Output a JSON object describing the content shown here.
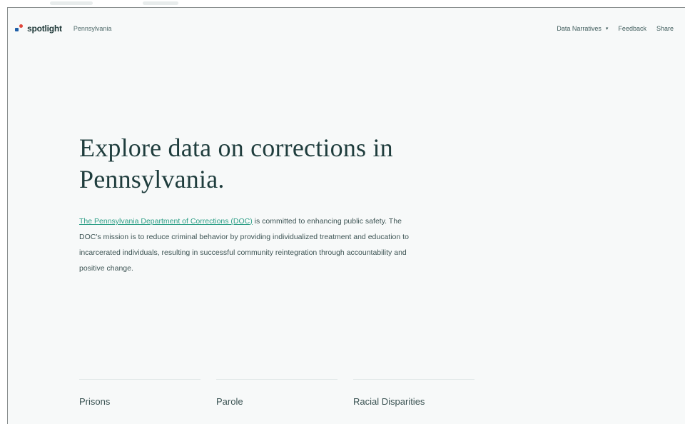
{
  "nav": {
    "brand": "spotlight",
    "state": "Pennsylvania",
    "data_narratives_label": "Data Narratives",
    "feedback_label": "Feedback",
    "share_label": "Share"
  },
  "hero": {
    "title": "Explore data on corrections in Pennsylvania.",
    "intro_link": "The Pennsylvania Department of Corrections (DOC)",
    "intro_text": " is committed to enhancing public safety. The DOC's mission is to reduce criminal behavior by providing individualized treatment and education to incarcerated individuals, resulting in successful community reintegration through accountability and positive change."
  },
  "cards": [
    {
      "label": "Prisons"
    },
    {
      "label": "Parole"
    },
    {
      "label": "Racial Disparities"
    }
  ],
  "colors": {
    "accent_link": "#2c9e86",
    "title_text": "#1f3d3d",
    "logo_blue": "#1f5fa8",
    "logo_red": "#e0453a"
  }
}
